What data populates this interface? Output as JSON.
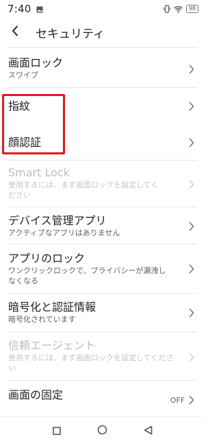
{
  "status": {
    "time": "7:40",
    "battery": "98"
  },
  "header": {
    "title": "セキュリティ"
  },
  "items": [
    {
      "title": "画面ロック",
      "subtitle": "スワイプ"
    },
    {
      "title": "指紋"
    },
    {
      "title": "顔認証"
    },
    {
      "title": "Smart Lock",
      "subtitle_line1": "使用するには、まず画面ロックを設定してく",
      "subtitle_line2": "ださい"
    },
    {
      "title": "デバイス管理アプリ",
      "subtitle": "アクティブなアプリはありません"
    },
    {
      "title": "アプリのロック",
      "subtitle_line1": "ワンクリックロックで、プライバシーが漏洩し",
      "subtitle_line2": "なくなる"
    },
    {
      "title": "暗号化と認証情報",
      "subtitle": "暗号化されています"
    },
    {
      "title": "信頼エージェント",
      "subtitle_line1": "使用するには、まず画面ロックを設定してくださ",
      "subtitle_line2": "い"
    },
    {
      "title": "画面の固定",
      "value": "OFF"
    }
  ],
  "icons": {
    "status": [
      "image-icon",
      "vibrate-icon",
      "wifi-icon",
      "battery-icon"
    ],
    "nav": [
      "recents-square-icon",
      "home-circle-icon",
      "back-triangle-icon"
    ]
  },
  "colors": {
    "highlight": "#e8141c",
    "disabled_text": "#bdbdbd"
  }
}
